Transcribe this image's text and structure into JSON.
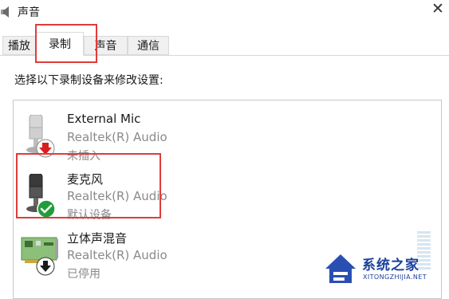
{
  "window": {
    "title": "声音"
  },
  "tabs": [
    {
      "label": "播放",
      "selected": false
    },
    {
      "label": "录制",
      "selected": true
    },
    {
      "label": "声音",
      "selected": false
    },
    {
      "label": "通信",
      "selected": false
    }
  ],
  "instruction": "选择以下录制设备来修改设置:",
  "devices": [
    {
      "name": "External Mic",
      "driver": "Realtek(R) Audio",
      "status": "未插入",
      "icon": "microphone-icon",
      "badge": "unplugged-down-arrow-icon"
    },
    {
      "name": "麦克风",
      "driver": "Realtek(R) Audio",
      "status": "默认设备",
      "icon": "microphone-icon",
      "badge": "default-check-icon"
    },
    {
      "name": "立体声混音",
      "driver": "Realtek(R) Audio",
      "status": "已停用",
      "icon": "sound-card-icon",
      "badge": "disabled-down-arrow-icon"
    }
  ],
  "watermark": {
    "text": "系统之家",
    "sub": "XITONGZHIJIA.NET"
  },
  "colors": {
    "annotation": "#e03b3b",
    "check": "#1f9d3a",
    "unplugged": "#d81e1e",
    "watermark": "#1b3f9c"
  }
}
